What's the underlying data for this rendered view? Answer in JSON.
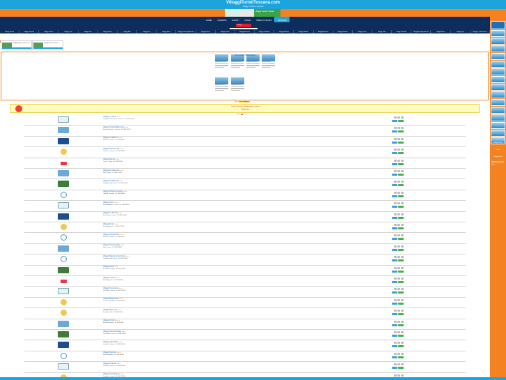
{
  "header": {
    "title": "VillaggiTuristiToscana.com",
    "subtitle": "Villaggi Turistici in Toscana",
    "banner_text": "Villaggi Turistici Toscana"
  },
  "nav": {
    "items": [
      "HOME",
      "OFFERTE",
      "EVENTI",
      "PRIMA",
      "PREMI TOSCANI",
      "TOSCANA"
    ],
    "highlight": "TOSCANA"
  },
  "subbar": {
    "tag": "Villaggi"
  },
  "regions": [
    "Villaggi Toscani",
    "Villaggi Grosseto",
    "Villaggi Livorno",
    "Villaggi Lucca",
    "Villaggi Isola",
    "Villaggi Marina",
    "Villaggi Elba",
    "Villaggi Pisa",
    "Villaggi Siena",
    "Villaggi Costa degli Etruschi",
    "Villaggi Firenze",
    "Villaggi Versilia",
    "Villaggi Maremma",
    "Villaggi Castiglione",
    "Villaggi Follonica",
    "Villaggi Orbetello",
    "Villaggi Argentario",
    "Villaggi Talamone",
    "Villaggi Cecina",
    "Villaggi Vada",
    "Villaggi Piombino",
    "Villaggi Riva degli Etruschi",
    "Villaggi Massa",
    "Villaggi Lago",
    "Villaggi di Tutta Toscana"
  ],
  "promos": {
    "header": "Villaggi in Offerta",
    "items": [
      "Villaggio Marina di Grosseto",
      "Villaggio Toscana Mare"
    ]
  },
  "section_title": "VILLAGGI TOSCANA",
  "gallery": [
    "Villaggio Marina Toscana",
    "Villaggio Argentario Mare",
    "Villaggio Costa Etruschi",
    "Villaggio Talamone",
    "Villaggio Elba Resort",
    "Villaggio Maremma Park"
  ],
  "pager_top": {
    "label": "Vai a",
    "button": "Cerca Villaggio"
  },
  "notice": {
    "line1": "Scopri le offerte dei villaggi turistici in Toscana",
    "line2": "Prenota ora"
  },
  "pager_bottom": {
    "prefix": "Pagina",
    "current": "1",
    "rest": "2 3 4 5"
  },
  "listings": [
    {
      "name": "Villaggio Le Marze",
      "info": "Castiglione della Pescaia · Grosseto · Tel. 0564 123456",
      "thumb": "c1"
    },
    {
      "name": "Villaggio Camping Baia Verde",
      "info": "Marina di Grosseto · Grosseto · Tel. 0564 337000",
      "thumb": "c0"
    },
    {
      "name": "Villaggio Il Gabbiano",
      "info": "Follonica · Grosseto · Tel. 0566 53335",
      "thumb": "c2"
    },
    {
      "name": "Villaggio Orizzonte Blu",
      "info": "Talamone · Grosseto · Tel. 0564 887000",
      "thumb": "c3"
    },
    {
      "name": "Villaggio Mare Sì",
      "info": "Cecina · Livorno · Tel. 0586 622000",
      "thumb": "c4"
    },
    {
      "name": "Villaggio La Capannina",
      "info": "Vada · Livorno · Tel. 0586 770000",
      "thumb": "c0"
    },
    {
      "name": "Villaggio Santapomata",
      "info": "Castiglione della Pescaia · Tel. 0564 941000",
      "thumb": "c5"
    },
    {
      "name": "Villaggio Orbetello Camping",
      "info": "Orbetello · Grosseto · Tel. 0564 820000",
      "thumb": "c6"
    },
    {
      "name": "Villaggio Il Sole",
      "info": "Marina di Bibbona · Livorno · Tel. 0586 600000",
      "thumb": "c1"
    },
    {
      "name": "Villaggio Le Tamerici",
      "info": "San Vincenzo · Livorno · Tel. 0565 701000",
      "thumb": "c2"
    },
    {
      "name": "Villaggio Etruria",
      "info": "Riva degli Etruschi · Tel. 0565 719000",
      "thumb": "c3"
    },
    {
      "name": "Villaggio Golfo del Sole",
      "info": "Follonica · Grosseto · Tel. 0566 57000",
      "thumb": "c6"
    },
    {
      "name": "Villaggio Toscana Verde",
      "info": "Vada · Livorno · Tel. 0586 788000",
      "thumb": "c0"
    },
    {
      "name": "Villaggio Maremma Sans Souci",
      "info": "Castiglione della Pescaia · Tel. 0564 933000",
      "thumb": "c6"
    },
    {
      "name": "Villaggio Pineta",
      "info": "Marina di Castagneto · Tel. 0565 744000",
      "thumb": "c5"
    },
    {
      "name": "Villaggio Il Veliero",
      "info": "Monte Argentario · Tel. 0564 870000",
      "thumb": "c4"
    },
    {
      "name": "Villaggio Costa Verde",
      "info": "Isola d'Elba · Livorno · Tel. 0565 910000",
      "thumb": "c1"
    },
    {
      "name": "Villaggio Baia del Sole",
      "info": "Lacona · Isola d'Elba · Tel. 0565 964000",
      "thumb": "c3"
    },
    {
      "name": "Villaggio Mareverde",
      "info": "Principina a Mare · Tel. 0564 31000",
      "thumb": "c3"
    },
    {
      "name": "Villaggio Il Fortino",
      "info": "Marina di Grosseto · Tel. 0564 34000",
      "thumb": "c0"
    },
    {
      "name": "Villaggio Toscana Holiday",
      "info": "Cecina Mare · Livorno · Tel. 0586 620000",
      "thumb": "c5"
    },
    {
      "name": "Villaggio Laguna Blu",
      "info": "Orbetello · Grosseto · Tel. 0564 860000",
      "thumb": "c2"
    },
    {
      "name": "Villaggio Oasi Park",
      "info": "Marina di Bibbona · Tel. 0586 600300",
      "thumb": "c6"
    },
    {
      "name": "Villaggio Punta Ala",
      "info": "Punta Ala · Grosseto · Tel. 0564 922000",
      "thumb": "c1"
    },
    {
      "name": "Villaggio Costa Etrusca",
      "info": "Donoratico · Livorno · Tel. 0565 775000",
      "thumb": "c3"
    }
  ],
  "sidebar": {
    "label1": "Villaggi Toscana",
    "label2": "Offerte",
    "label3": "Villaggi Estate",
    "text": "Prenota la tua vacanza nei migliori villaggi turistici della Toscana"
  },
  "colors": {
    "primary": "#1da4dc",
    "accent": "#f58220",
    "navy": "#0d2e5c"
  }
}
